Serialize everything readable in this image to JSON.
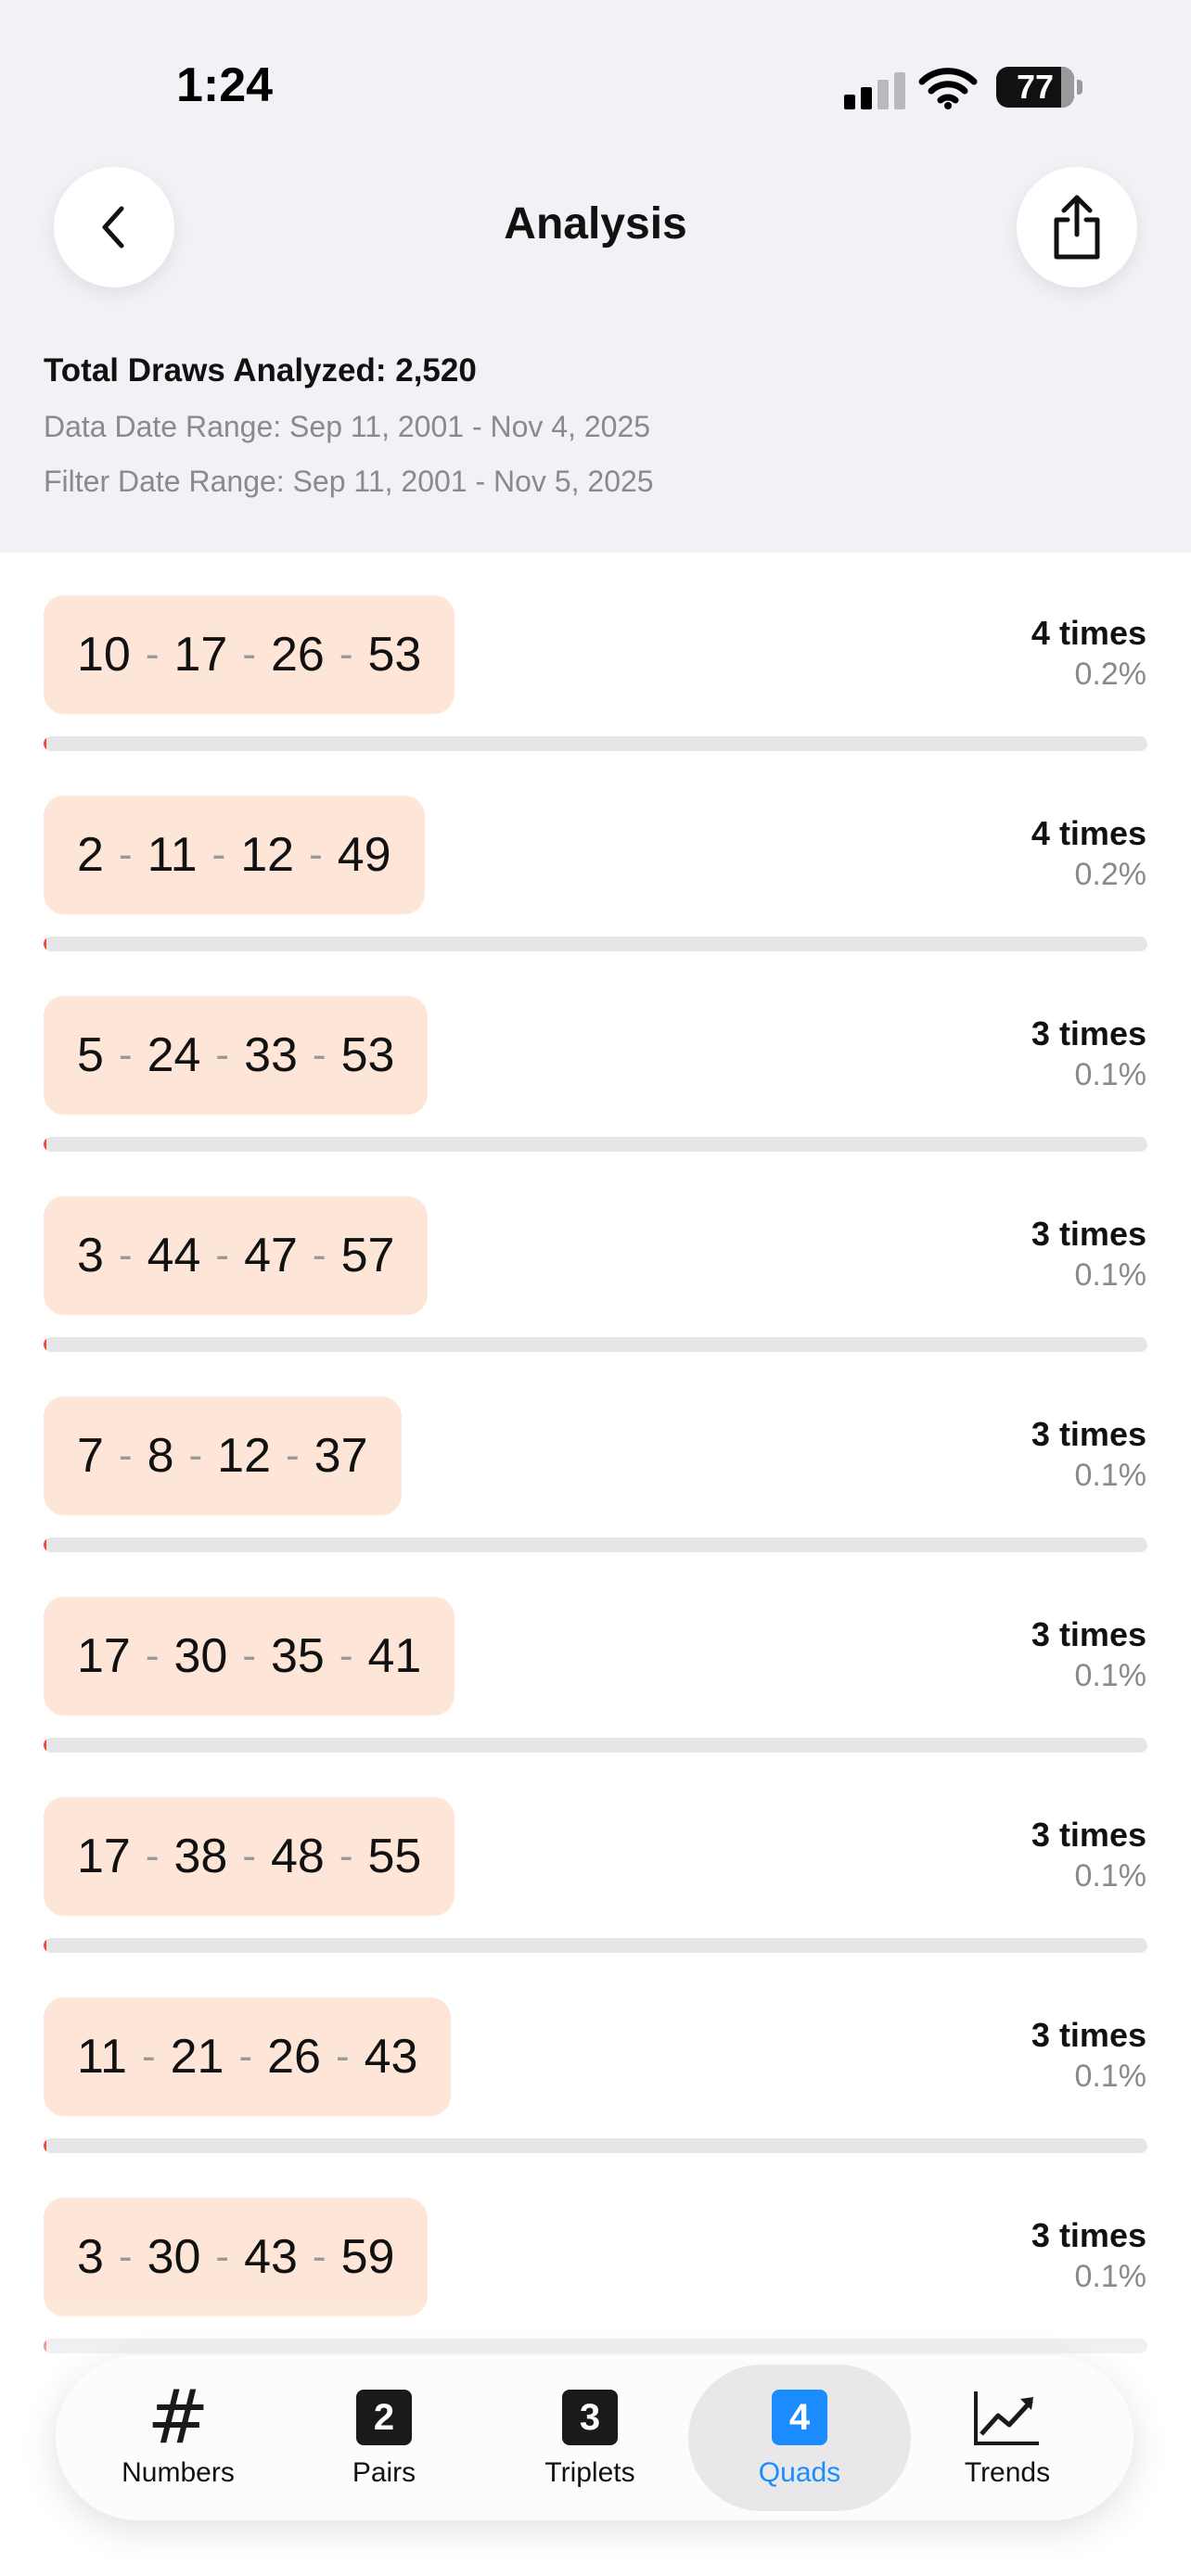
{
  "status_bar": {
    "time": "1:24",
    "battery": "77"
  },
  "header": {
    "title": "Analysis"
  },
  "summary": {
    "total": "Total Draws Analyzed: 2,520",
    "data_range": "Data Date Range: Sep 11, 2001 - Nov 4, 2025",
    "filter_range": "Filter Date Range: Sep 11, 2001 - Nov 5, 2025"
  },
  "quads": [
    {
      "numbers": [
        "10",
        "17",
        "26",
        "53"
      ],
      "count": "4 times",
      "percent": "0.2%",
      "fraction": 0.002
    },
    {
      "numbers": [
        "2",
        "11",
        "12",
        "49"
      ],
      "count": "4 times",
      "percent": "0.2%",
      "fraction": 0.002
    },
    {
      "numbers": [
        "5",
        "24",
        "33",
        "53"
      ],
      "count": "3 times",
      "percent": "0.1%",
      "fraction": 0.001
    },
    {
      "numbers": [
        "3",
        "44",
        "47",
        "57"
      ],
      "count": "3 times",
      "percent": "0.1%",
      "fraction": 0.001
    },
    {
      "numbers": [
        "7",
        "8",
        "12",
        "37"
      ],
      "count": "3 times",
      "percent": "0.1%",
      "fraction": 0.001
    },
    {
      "numbers": [
        "17",
        "30",
        "35",
        "41"
      ],
      "count": "3 times",
      "percent": "0.1%",
      "fraction": 0.001
    },
    {
      "numbers": [
        "17",
        "38",
        "48",
        "55"
      ],
      "count": "3 times",
      "percent": "0.1%",
      "fraction": 0.001
    },
    {
      "numbers": [
        "11",
        "21",
        "26",
        "43"
      ],
      "count": "3 times",
      "percent": "0.1%",
      "fraction": 0.001
    },
    {
      "numbers": [
        "3",
        "30",
        "43",
        "59"
      ],
      "count": "3 times",
      "percent": "0.1%",
      "fraction": 0.001
    }
  ],
  "tabs": [
    {
      "label": "Numbers",
      "icon": "hash-icon",
      "glyph": "#"
    },
    {
      "label": "Pairs",
      "icon": "pairs-icon",
      "glyph": "2"
    },
    {
      "label": "Triplets",
      "icon": "triplets-icon",
      "glyph": "3"
    },
    {
      "label": "Quads",
      "icon": "quads-icon",
      "glyph": "4",
      "active": true
    },
    {
      "label": "Trends",
      "icon": "trend-chart-icon"
    }
  ],
  "colors": {
    "accent": "#1a8cff",
    "chip": "#fde6d7",
    "bar_fill": "#f04a3a",
    "bar_track": "#e6e6e9"
  }
}
